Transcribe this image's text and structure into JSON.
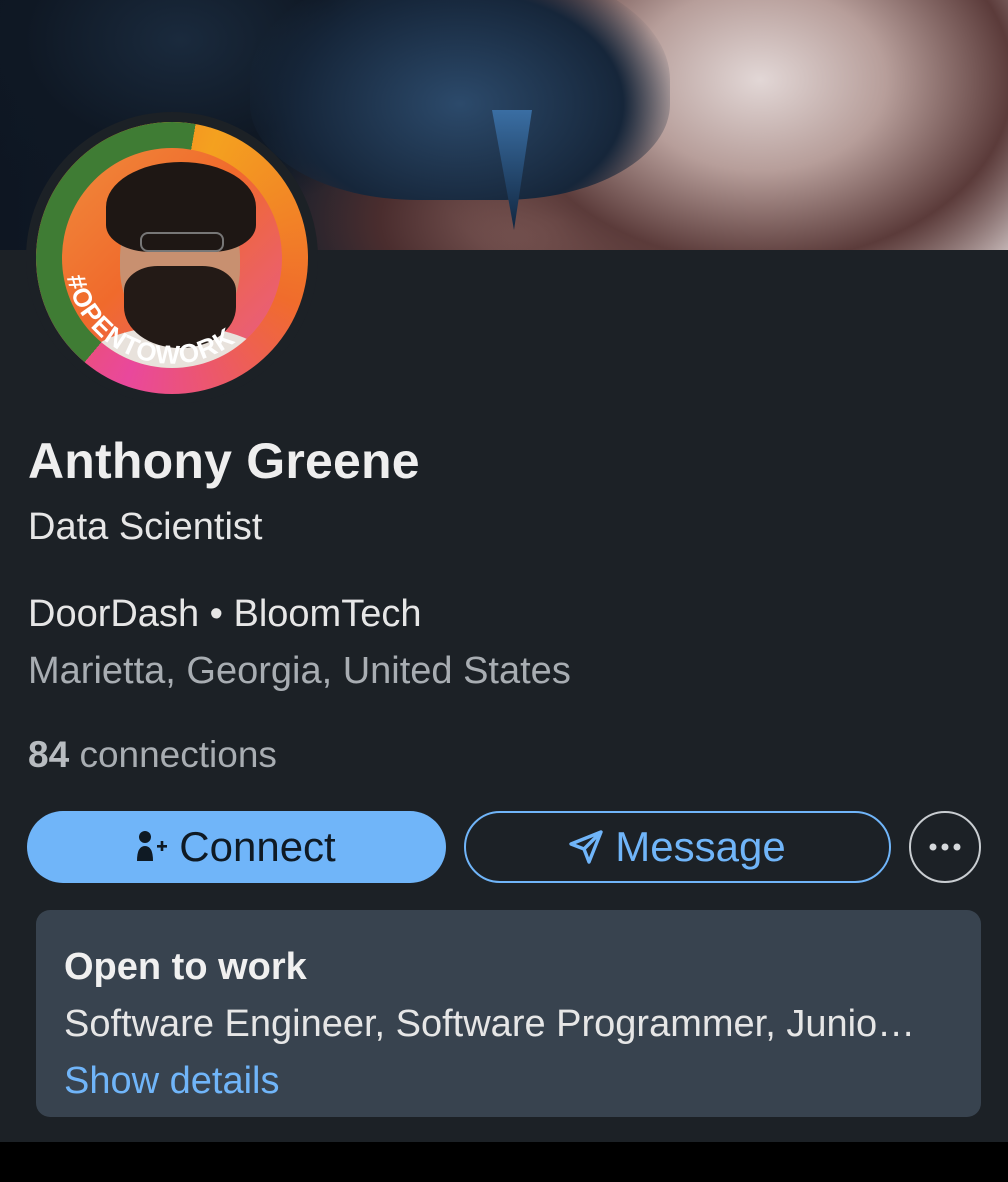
{
  "profile": {
    "name": "Anthony Greene",
    "headline": "Data Scientist",
    "companies": "DoorDash • BloomTech",
    "location": "Marietta, Georgia, United States",
    "connections_count": "84",
    "connections_label": "connections",
    "avatar_badge": "#OPENTOWORK"
  },
  "actions": {
    "connect_label": "Connect",
    "message_label": "Message",
    "more_icon": "ellipsis-icon"
  },
  "open_to_work": {
    "title": "Open to work",
    "roles": "Software Engineer, Software Programmer, Junio…",
    "link_label": "Show details"
  },
  "colors": {
    "accent": "#70b5f9",
    "background": "#1c2126",
    "panel": "#38434f",
    "open_to_work_green": "#3f7c34"
  }
}
